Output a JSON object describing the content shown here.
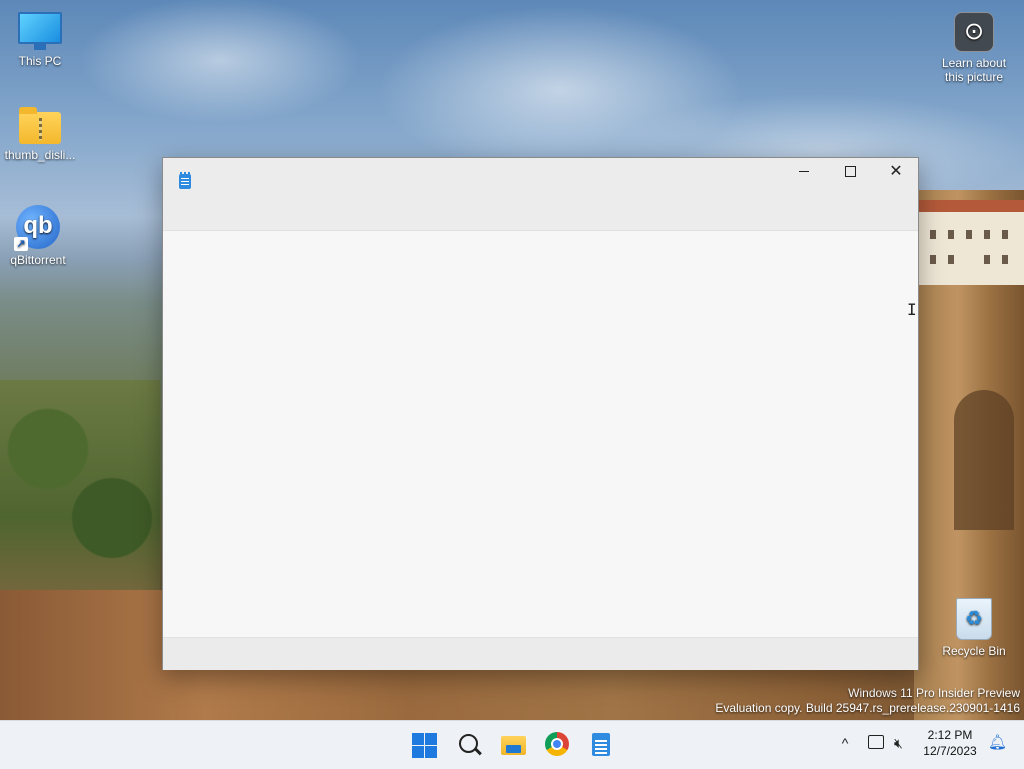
{
  "desktop": {
    "icons": [
      {
        "label": "This PC",
        "icon": "monitor-icon"
      },
      {
        "label": "thumb_disli...",
        "icon": "zip-folder-icon"
      },
      {
        "label": "qBittorrent",
        "icon": "qbittorrent-icon"
      },
      {
        "label": "Learn about\nthis picture",
        "icon": "camera-icon"
      },
      {
        "label": "Recycle Bin",
        "icon": "recycle-bin-icon"
      }
    ],
    "watermark": {
      "line1": "Windows 11 Pro Insider Preview",
      "line2": "Evaluation copy. Build 25947.rs_prerelease.230901-1416"
    }
  },
  "window": {
    "app_icon": "notepad-icon",
    "minimize_label": "Minimize",
    "maximize_label": "Maximize",
    "close_label": "✕"
  },
  "taskbar": {
    "apps": [
      "start",
      "search",
      "file-explorer",
      "chrome",
      "notepad"
    ],
    "tray": {
      "chevron": "^",
      "time": "2:12 PM",
      "date": "12/7/2023"
    }
  }
}
